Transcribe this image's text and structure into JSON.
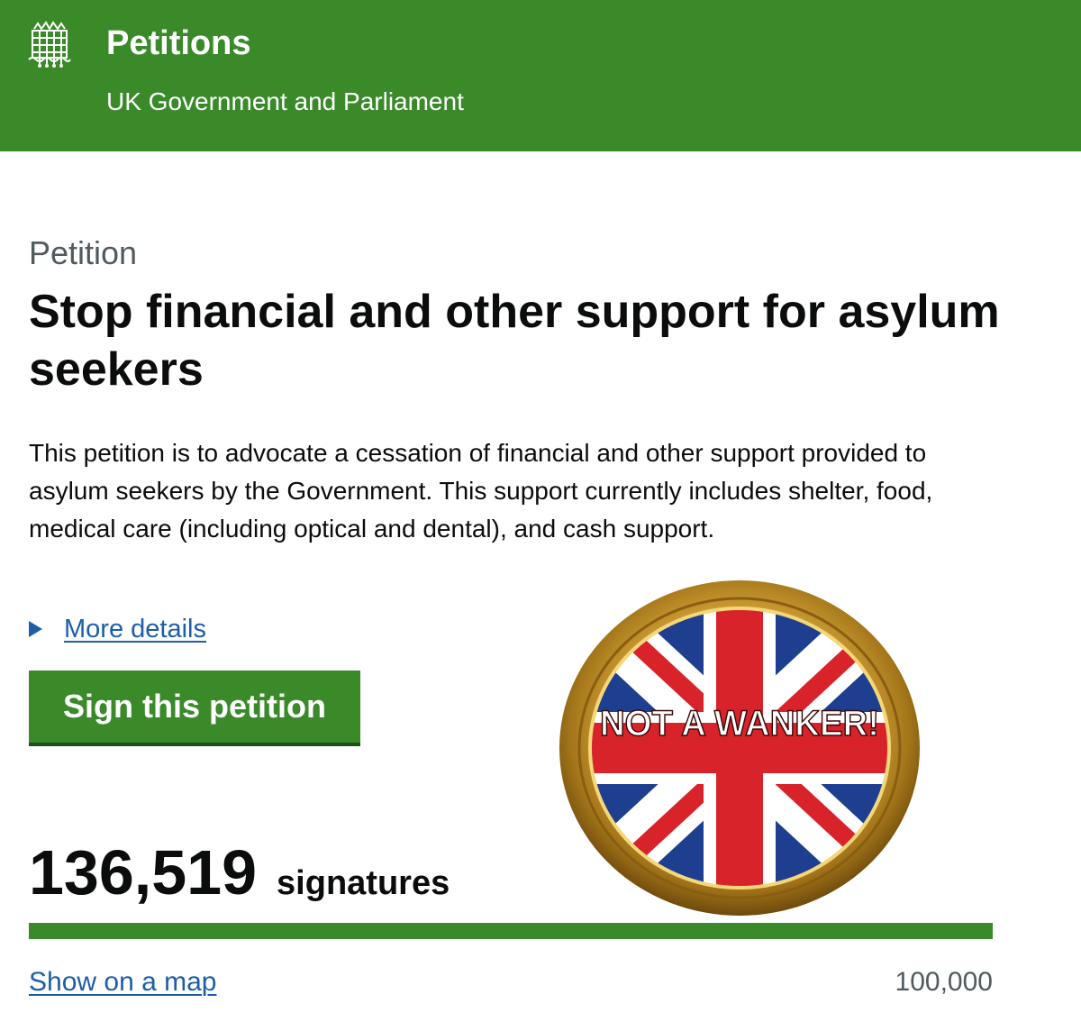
{
  "header": {
    "title": "Petitions",
    "subtitle": "UK Government and Parliament",
    "logo_icon": "portcullis-icon",
    "background_color": "#3a8a2a"
  },
  "petition": {
    "caption": "Petition",
    "title": "Stop financial and other support for asylum seekers",
    "description": "This petition is to advocate a cessation of financial and other support provided to asylum seekers by the Government. This support currently includes shelter, food, medical care (including optical and dental), and cash support.",
    "more_details_label": "More details",
    "sign_button_label": "Sign this petition"
  },
  "signatures": {
    "count": "136,519",
    "label": "signatures",
    "target": "100,000",
    "progress_fraction": 1.0,
    "show_map_label": "Show on a map"
  },
  "badge": {
    "text": "NOT A WANKER!",
    "icon": "union-jack-badge-icon"
  },
  "colors": {
    "link": "#1d5ea8",
    "green": "#3a8a2a",
    "secondary_text": "#505a5f"
  }
}
